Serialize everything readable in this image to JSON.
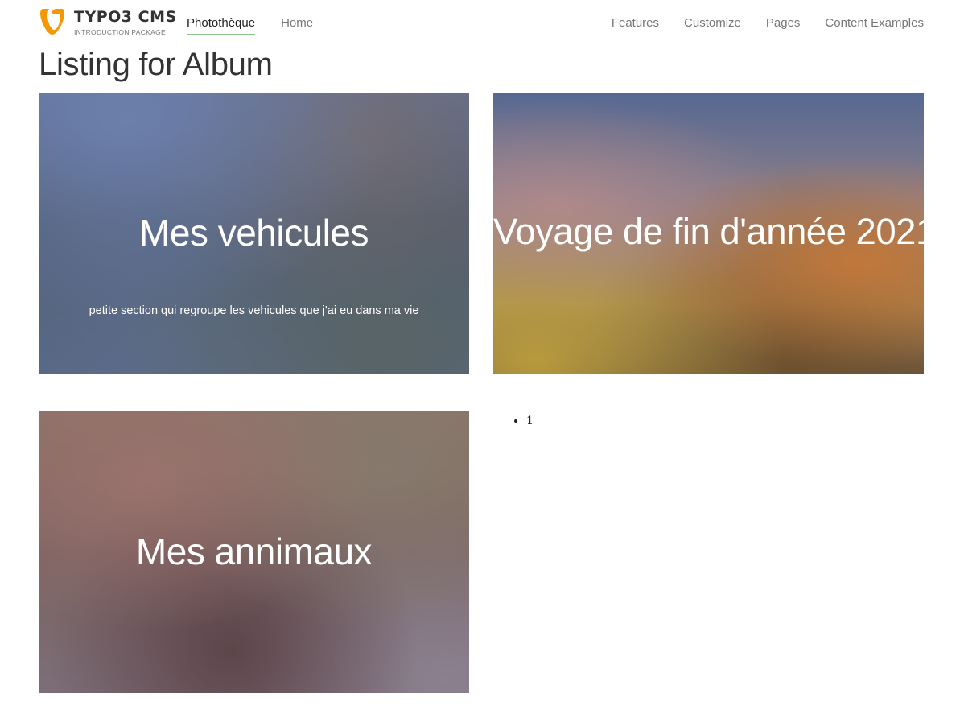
{
  "logo": {
    "title": "TYPO3 CMS",
    "subtitle": "INTRODUCTION PACKAGE",
    "brand_color": "#f49700",
    "icon": "typo3-logo-icon"
  },
  "nav": {
    "left": [
      {
        "label": "Photothèque",
        "active": true
      },
      {
        "label": "Home",
        "active": false
      }
    ],
    "right": [
      {
        "label": "Features"
      },
      {
        "label": "Customize"
      },
      {
        "label": "Pages"
      },
      {
        "label": "Content Examples"
      }
    ],
    "active_underline_color": "#8cc58a"
  },
  "page": {
    "title": "Listing for Album"
  },
  "albums": [
    {
      "title": "Mes vehicules",
      "description": "petite section qui regroupe les vehicules que j'ai eu dans ma vie"
    },
    {
      "title": "Voyage de fin d'année 2021",
      "description": ""
    },
    {
      "title": "Mes annimaux",
      "description": ""
    }
  ],
  "pagination": {
    "pages": [
      "1"
    ]
  }
}
